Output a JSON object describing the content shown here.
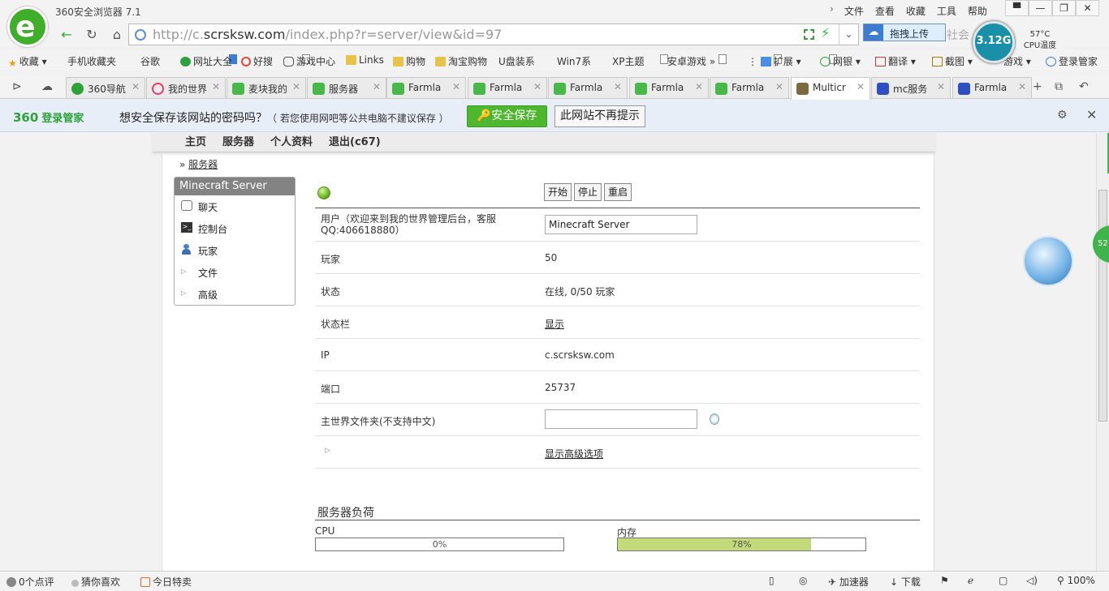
{
  "browser": {
    "title": "360安全浏览器 7.1",
    "menu": [
      "文件",
      "查看",
      "收藏",
      "工具",
      "帮助"
    ],
    "url_prefix": "http://c.",
    "url_domain": "scrsksw.com",
    "url_path": "/index.php?r=server/view&id=97",
    "cloud_upload": "拖拽上传",
    "search_fragment": "社会",
    "gauge_value": "3.12G",
    "cpu_temp": "57°C",
    "cpu_temp_label": "CPU温度"
  },
  "bookmarks": [
    "收藏",
    "手机收藏夹",
    "谷歌",
    "网址大全",
    "好搜",
    "游戏中心",
    "Links",
    "购物",
    "淘宝购物",
    "U盘装系",
    "Win7系",
    "XP主题",
    "安卓游戏",
    "扩展",
    "网银",
    "翻译",
    "截图",
    "游戏",
    "登录管家"
  ],
  "tabs": [
    {
      "label": "360导航",
      "icon": "tab-icon-360"
    },
    {
      "label": "我的世界",
      "icon": "tab-icon-search"
    },
    {
      "label": "麦块我的",
      "icon": "tab-icon-wechat"
    },
    {
      "label": "服务器",
      "icon": "tab-icon-wechat"
    },
    {
      "label": "Farmla",
      "icon": "tab-icon-wechat"
    },
    {
      "label": "Farmla",
      "icon": "tab-icon-wechat"
    },
    {
      "label": "Farmla",
      "icon": "tab-icon-wechat"
    },
    {
      "label": "Farmla",
      "icon": "tab-icon-wechat"
    },
    {
      "label": "Farmla",
      "icon": "tab-icon-wechat"
    },
    {
      "label": "Multicr",
      "icon": "tab-icon-mc"
    },
    {
      "label": "mc服务",
      "icon": "tab-icon-paw"
    },
    {
      "label": "Farmla",
      "icon": "tab-icon-paw"
    }
  ],
  "password_bar": {
    "brand": "360",
    "brand_sub": "登录管家",
    "message": "想安全保存该网站的密码吗？",
    "note": "（ 若您使用网吧等公共电脑不建议保存 ）",
    "save": "安全保存",
    "never": "此网站不再提示"
  },
  "site": {
    "nav": [
      "主页",
      "服务器",
      "个人资料",
      "退出(c67)"
    ],
    "crumb_prefix": "»",
    "crumb": "服务器",
    "panel_title": "Minecraft Server",
    "panel_items": [
      "聊天",
      "控制台",
      "玩家",
      "文件",
      "高级"
    ],
    "controls": [
      "开始",
      "停止",
      "重启"
    ],
    "rows": {
      "user_label": "用户（欢迎来到我的世界管理后台，客服QQ:406618880）",
      "user_value": "Minecraft Server",
      "players_label": "玩家",
      "players_value": "50",
      "status_label": "状态",
      "status_value": "在线, 0/50 玩家",
      "statusbar_label": "状态栏",
      "statusbar_value": "显示",
      "ip_label": "IP",
      "ip_value": "c.scrsksw.com",
      "port_label": "端口",
      "port_value": "25737",
      "world_label": "主世界文件夹(不支持中文)",
      "world_value": "",
      "advanced_link": "显示高级选项"
    },
    "load_title": "服务器负荷",
    "cpu_label": "CPU",
    "cpu_pct": "0%",
    "cpu_value": 0,
    "mem_label": "内存",
    "mem_pct": "78%",
    "mem_value": 78
  },
  "statusbar": {
    "comments": "0个点评",
    "guess": "猜你喜欢",
    "deals": "今日特卖",
    "accel": "加速器",
    "download": "下载",
    "zoom": "100%"
  },
  "side_badge": "52"
}
